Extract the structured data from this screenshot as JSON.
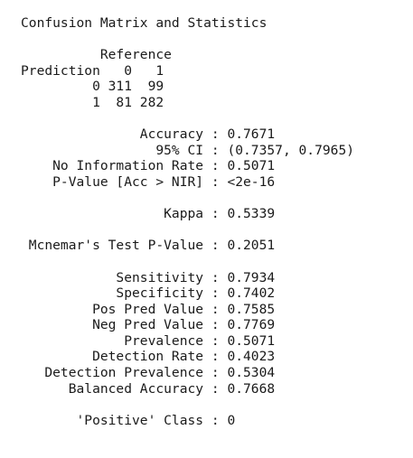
{
  "output": {
    "lines": [
      "Confusion Matrix and Statistics",
      "",
      "          Reference",
      "Prediction   0   1",
      "         0 311  99",
      "         1  81 282",
      "",
      "               Accuracy : 0.7671",
      "                 95% CI : (0.7357, 0.7965)",
      "    No Information Rate : 0.5071",
      "    P-Value [Acc > NIR] : <2e-16",
      "",
      "                  Kappa : 0.5339",
      "",
      " Mcnemar's Test P-Value : 0.2051",
      "",
      "            Sensitivity : 0.7934",
      "            Specificity : 0.7402",
      "         Pos Pred Value : 0.7585",
      "         Neg Pred Value : 0.7769",
      "             Prevalence : 0.5071",
      "         Detection Rate : 0.4023",
      "   Detection Prevalence : 0.5304",
      "      Balanced Accuracy : 0.7668",
      "",
      "       'Positive' Class : 0"
    ]
  }
}
